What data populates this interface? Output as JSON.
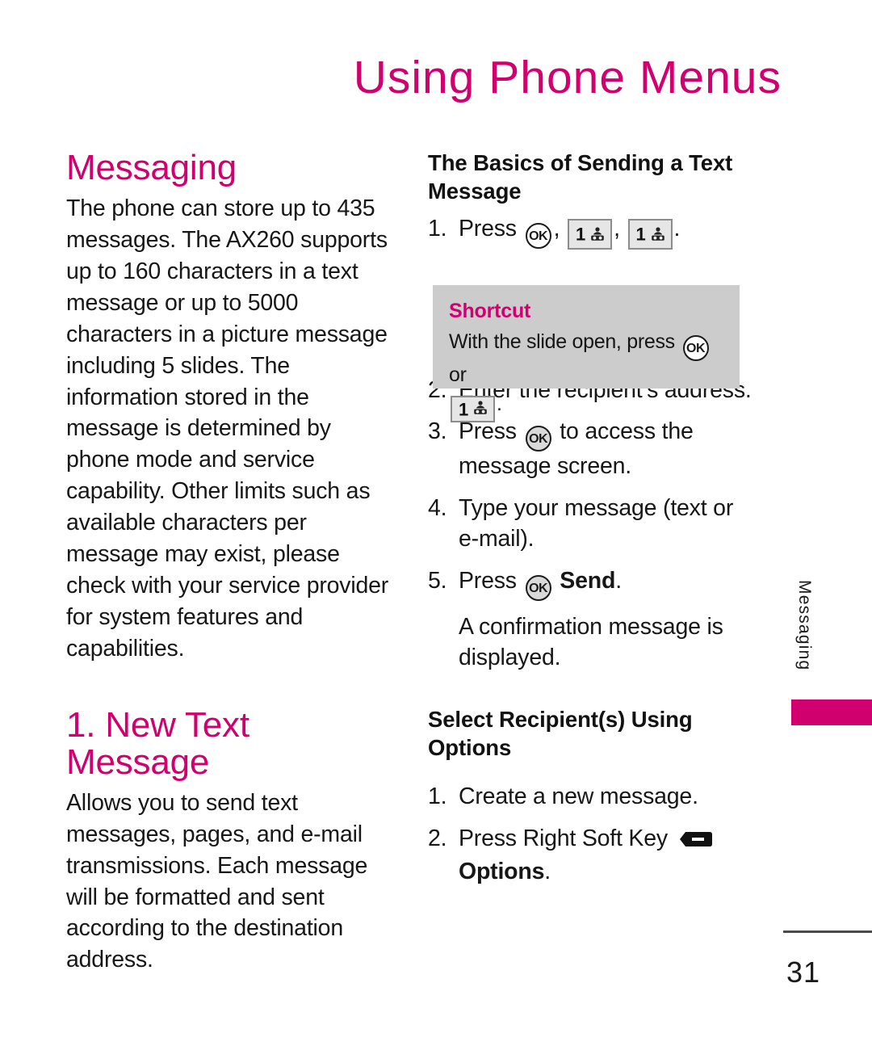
{
  "header": {
    "title": "Using Phone Menus",
    "accent_color": "#d0006f"
  },
  "left_column": {
    "section_title": "Messaging",
    "intro_paragraph": "The phone can store up to 435 messages. The AX260 supports up to 160 characters in a text message or up to 5000 characters in a picture message including 5 slides. The information stored in the message is determined by phone mode and service capability. Other limits such as available characters per message may exist, please check with your service provider for system features and capabilities.",
    "subsection_title": "1. New Text Message",
    "subsection_paragraph": "Allows you to send text messages, pages, and e-mail transmissions. Each message will be formatted and sent according to the destination address."
  },
  "right_column": {
    "basics_heading": "The Basics of Sending a Text Message",
    "basics_steps": [
      {
        "num": "1.",
        "before": "Press",
        "keys": [
          "ok-key",
          "one-key",
          "one-key"
        ],
        "after": "."
      },
      {
        "num": "2.",
        "text": "Enter the recipient’s address."
      },
      {
        "num": "3.",
        "before": "Press",
        "keys": [
          "ok-key-filled"
        ],
        "after": "to access the message screen."
      },
      {
        "num": "4.",
        "text": "Type your message (text or e-mail)."
      },
      {
        "num": "5.",
        "before": "Press",
        "keys": [
          "ok-key-filled"
        ],
        "bold": "Send",
        "after": "."
      },
      {
        "num": "",
        "text": "A confirmation message is displayed."
      }
    ],
    "shortcut": {
      "title": "Shortcut",
      "text_before": "With the slide open, press",
      "text_middle": "or",
      "text_after": "."
    },
    "options_heading": "Select Recipient(s) Using Options",
    "options_steps": [
      {
        "num": "1.",
        "text": "Create a new message."
      },
      {
        "num": "2.",
        "before": "Press Right Soft Key",
        "keys": [
          "soft-key"
        ],
        "bold": "Options",
        "after": "."
      }
    ]
  },
  "side_tab": {
    "label": "Messaging",
    "bar_color": "#d0006f"
  },
  "footer": {
    "page_number": "31"
  },
  "key_glyphs": {
    "ok_label": "OK",
    "one_digit": "1"
  }
}
